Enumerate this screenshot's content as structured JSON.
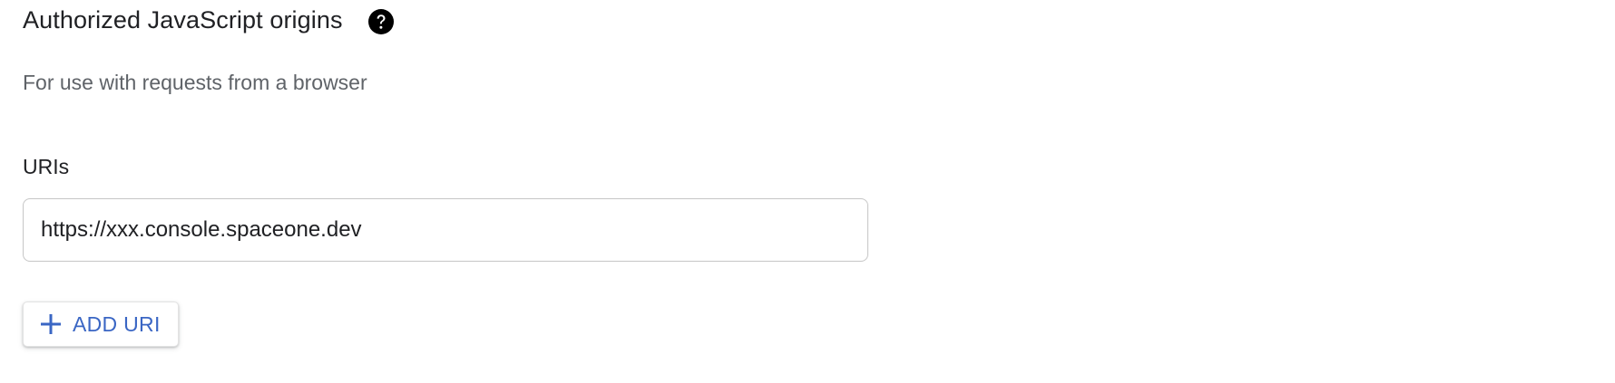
{
  "section": {
    "title": "Authorized JavaScript origins",
    "subtitle": "For use with requests from a browser",
    "help_icon": "help-circle-icon"
  },
  "uris": {
    "label": "URIs",
    "items": [
      {
        "value": "https://xxx.console.spaceone.dev"
      }
    ]
  },
  "add_button": {
    "label": "ADD URI",
    "icon": "plus-icon"
  },
  "colors": {
    "accent": "#3a66c4",
    "text_primary": "#202124",
    "text_secondary": "#5f6368",
    "border": "#c6c6c6"
  }
}
